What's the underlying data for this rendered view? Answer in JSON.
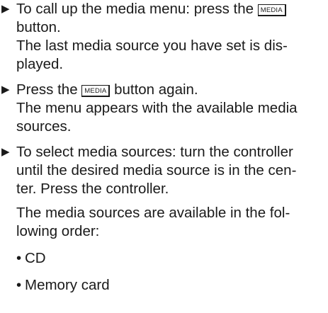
{
  "steps": [
    {
      "pre": "To call up the media menu: press the ",
      "button": "MEDIA",
      "post": "button.",
      "result": [
        "The last media source you have set is dis-",
        "played."
      ]
    },
    {
      "pre": "Press the ",
      "button": "MEDIA",
      "post": " button again.",
      "result": [
        "The menu appears with the available media",
        "sources."
      ]
    },
    {
      "lines": [
        "To select media sources: turn the controller",
        "until the desired media source is in the cen-",
        "ter. Press the controller."
      ],
      "note": [
        "The media sources are available in the fol-",
        "lowing order:"
      ]
    }
  ],
  "sources": [
    "CD",
    "Memory card"
  ],
  "arrow_glyph": "▶",
  "bullet_glyph": "•"
}
